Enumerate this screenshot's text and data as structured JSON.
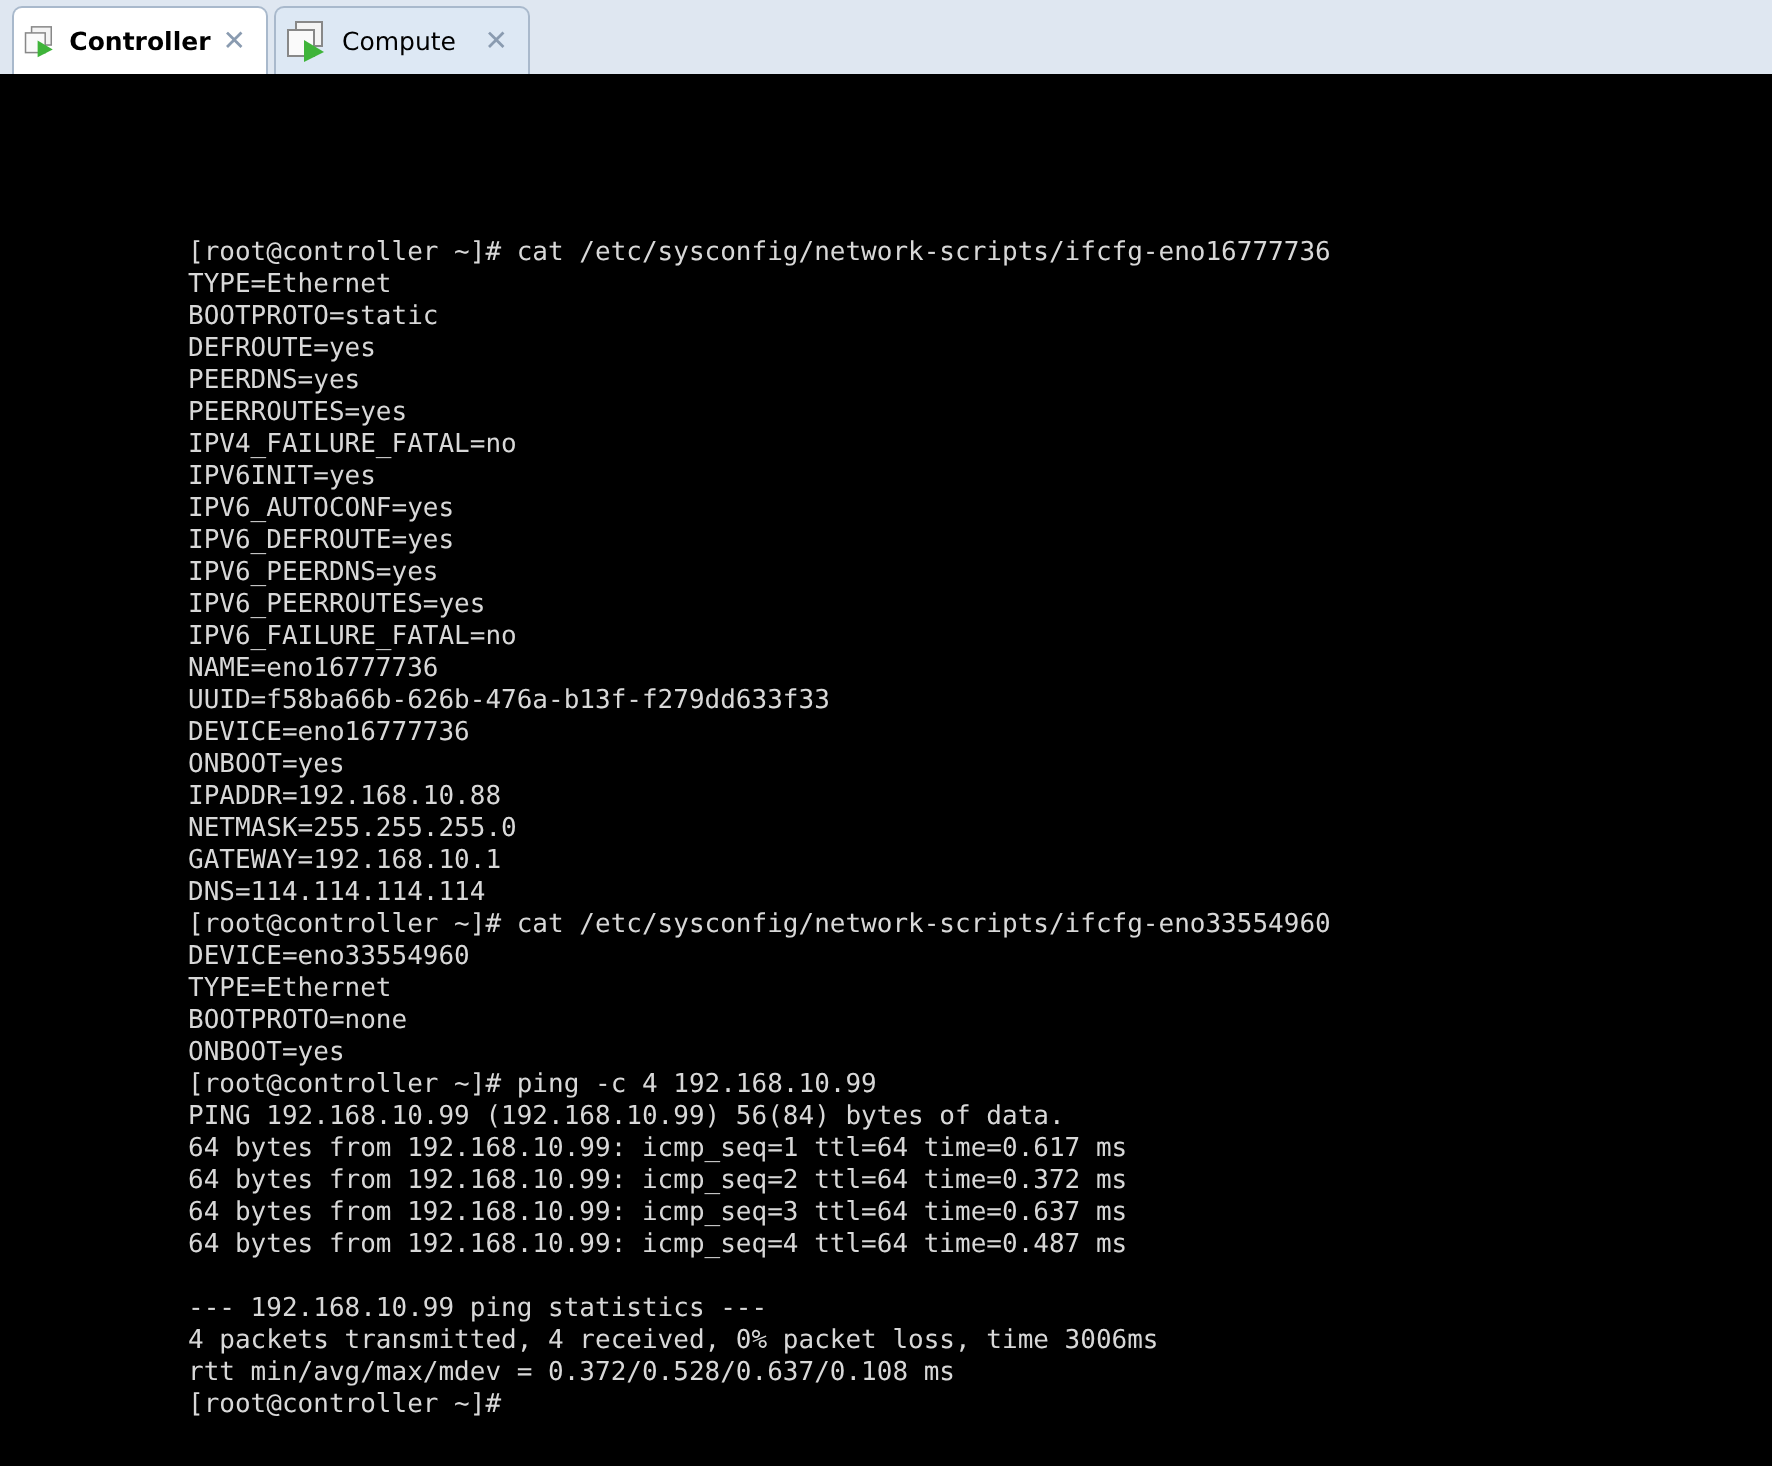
{
  "tabs": [
    {
      "label": "Controller",
      "selected": true,
      "close": "✕"
    },
    {
      "label": "Compute",
      "selected": false,
      "close": "✕"
    }
  ],
  "terminal": {
    "blocks": [
      [
        "[root@controller ~]# cat /etc/sysconfig/network-scripts/ifcfg-eno16777736",
        "TYPE=Ethernet",
        "BOOTPROTO=static",
        "DEFROUTE=yes",
        "PEERDNS=yes",
        "PEERROUTES=yes",
        "IPV4_FAILURE_FATAL=no",
        "IPV6INIT=yes",
        "IPV6_AUTOCONF=yes",
        "IPV6_DEFROUTE=yes",
        "IPV6_PEERDNS=yes",
        "IPV6_PEERROUTES=yes",
        "IPV6_FAILURE_FATAL=no",
        "NAME=eno16777736",
        "UUID=f58ba66b-626b-476a-b13f-f279dd633f33",
        "DEVICE=eno16777736",
        "ONBOOT=yes",
        "IPADDR=192.168.10.88",
        "NETMASK=255.255.255.0",
        "GATEWAY=192.168.10.1",
        "DNS=114.114.114.114",
        "[root@controller ~]# cat /etc/sysconfig/network-scripts/ifcfg-eno33554960",
        "DEVICE=eno33554960",
        "TYPE=Ethernet",
        "BOOTPROTO=none",
        "ONBOOT=yes",
        "[root@controller ~]# ping -c 4 192.168.10.99",
        "PING 192.168.10.99 (192.168.10.99) 56(84) bytes of data.",
        "64 bytes from 192.168.10.99: icmp_seq=1 ttl=64 time=0.617 ms",
        "64 bytes from 192.168.10.99: icmp_seq=2 ttl=64 time=0.372 ms",
        "64 bytes from 192.168.10.99: icmp_seq=3 ttl=64 time=0.637 ms",
        "64 bytes from 192.168.10.99: icmp_seq=4 ttl=64 time=0.487 ms"
      ],
      [
        "--- 192.168.10.99 ping statistics ---",
        "4 packets transmitted, 4 received, 0% packet loss, time 3006ms",
        "rtt min/avg/max/mdev = 0.372/0.528/0.637/0.108 ms",
        "[root@controller ~]#"
      ]
    ]
  }
}
